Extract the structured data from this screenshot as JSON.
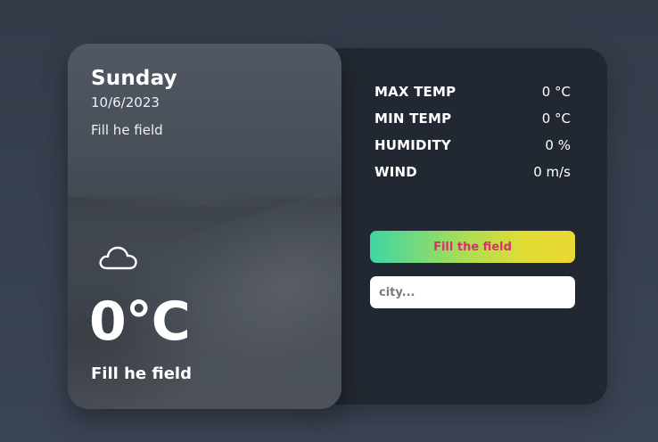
{
  "weather_card": {
    "day": "Sunday",
    "date": "10/6/2023",
    "location": "Fill he field",
    "icon": "cloud-icon",
    "temperature": "0°C",
    "description": "Fill he field"
  },
  "stats": [
    {
      "label": "MAX TEMP",
      "value": "0 °C"
    },
    {
      "label": "MIN TEMP",
      "value": "0 °C"
    },
    {
      "label": "HUMIDITY",
      "value": "0 %"
    },
    {
      "label": "WIND",
      "value": "0 m/s"
    }
  ],
  "action_button": {
    "label": "Fill the field"
  },
  "search": {
    "placeholder": "city...",
    "value": ""
  },
  "colors": {
    "background": "#353d4b",
    "panel": "#222831",
    "button_gradient_start": "#3dd6a5",
    "button_gradient_end": "#ead834",
    "button_text": "#d6316c"
  }
}
